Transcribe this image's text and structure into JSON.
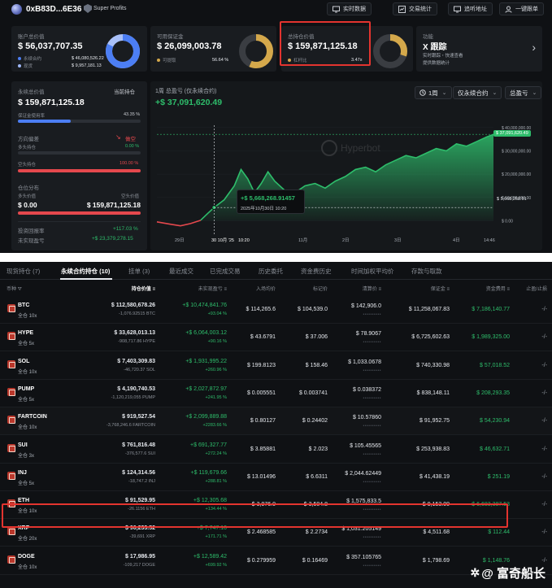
{
  "header": {
    "address": "0xB83D...6E36",
    "badge": "Super Profits",
    "buttons": [
      "实时数据",
      "交易统计",
      "追听地址",
      "一键跟单"
    ]
  },
  "cards": {
    "account": {
      "label": "账户总价值",
      "value": "$ 56,037,707.35",
      "rows": [
        {
          "label": "永续合约",
          "value": "$ 46,080,526.22"
        },
        {
          "label": "现货",
          "value": "$ 9,957,181.13"
        }
      ],
      "split": [
        0.82,
        0.18
      ]
    },
    "margin": {
      "label": "可用保证金",
      "value": "$ 26,099,003.78",
      "row_label": "可提取",
      "row_value": "56.64 %",
      "ratio": 0.5664
    },
    "position": {
      "label": "总持仓价值",
      "value": "$ 159,871,125.18",
      "row_label": "杠杆比",
      "row_value": "3.47x",
      "ratio": 0.3
    },
    "feature": {
      "label": "功能",
      "title": "X 跟踪",
      "line1": "实时跟踪・快速查看",
      "line2": "提供数据统计"
    }
  },
  "left": {
    "perp_label": "永续总价值",
    "current_label": "当前持仓",
    "perp_value": "$ 159,871,125.18",
    "margin_used_label": "保证金使用率",
    "margin_used_pct": "43.35 %",
    "margin_used_ratio": 0.4335,
    "direction_label": "方向偏差",
    "direction_value": "做空",
    "long_label": "多头持仓",
    "long_pct": "0.00 %",
    "short_label": "空头持仓",
    "short_pct": "100.00 %",
    "dist_label": "仓位分布",
    "long_value_label": "多头价值",
    "short_value_label": "空头价值",
    "long_value": "$ 0.00",
    "short_value": "$ 159,871,125.18",
    "roi_label": "投资回报率",
    "roi_value": "+117.03 %",
    "upnl_label": "未实现盈亏",
    "upnl_value": "+$ 23,379,278.15"
  },
  "chart": {
    "title": "1周 总盈亏 (仅永续合约)",
    "value": "+$ 37,091,620.49",
    "controls": {
      "range": "1周",
      "scope": "仅永续合约",
      "metric": "总盈亏"
    },
    "watermark": "Hyperbot",
    "tooltip": {
      "value": "+$ 5,668,268.91457",
      "date": "2025年10月30日 10:20"
    },
    "current_label": "$ 37,091,620.49",
    "marker_label": "$ 5,668,268.91"
  },
  "chart_data": {
    "type": "area",
    "title": "1周 总盈亏 (仅永续合约)",
    "x_ticks": [
      "29日",
      "30 10月 '25",
      "10:20",
      "11月",
      "2日",
      "3日",
      "4日",
      "14:46"
    ],
    "y_ticks": [
      "$ 40,000,000.00",
      "$ 30,000,000.00",
      "$ 20,000,000.00",
      "$ 10,000,000.00",
      "$ 0.00"
    ],
    "ylim": [
      -3000000,
      41000000
    ],
    "x": [
      0,
      0.04,
      0.07,
      0.1,
      0.13,
      0.15,
      0.17,
      0.2,
      0.23,
      0.25,
      0.27,
      0.29,
      0.31,
      0.33,
      0.35,
      0.38,
      0.41,
      0.44,
      0.47,
      0.5,
      0.53,
      0.56,
      0.59,
      0.62,
      0.65,
      0.68,
      0.71,
      0.74,
      0.77,
      0.8,
      0.83,
      0.86,
      0.89,
      0.92,
      0.95,
      0.98,
      1.0
    ],
    "values": [
      -500000,
      -1500000,
      -2200000,
      -1200000,
      200000,
      3000000,
      5668268,
      9000000,
      15000000,
      22000000,
      18000000,
      12000000,
      16000000,
      21000000,
      17000000,
      13000000,
      12000000,
      15000000,
      16000000,
      14000000,
      17000000,
      19000000,
      22000000,
      23000000,
      21000000,
      24000000,
      26000000,
      28000000,
      27000000,
      29000000,
      31000000,
      30000000,
      33000000,
      32000000,
      34000000,
      36000000,
      37091620
    ]
  },
  "tabs": [
    "现货持仓 (7)",
    "永续合约持仓 (10)",
    "挂单 (3)",
    "最近成交",
    "已完成交易",
    "历史委托",
    "资金费历史",
    "时间加权平均价",
    "存款与取款"
  ],
  "columns": [
    "币种",
    "持仓价值",
    "未实现盈亏",
    "入场均价",
    "标记价",
    "清算价",
    "保证金",
    "资金费用",
    "止盈/止损"
  ],
  "rows": [
    {
      "sym": "BTC",
      "lev": "全仓 10x",
      "value": "$ 112,580,678.26",
      "size": "-1,076.92515 BTC",
      "pnl": "+$ 10,474,841.76",
      "pnl_pct": "+93.04 %",
      "entry": "$ 114,265.6",
      "mark": "$ 104,539.0",
      "liq": "$ 142,906.0",
      "margin": "$ 11,258,067.83",
      "funding": "$ 7,186,140.77",
      "tpsl": "-/-"
    },
    {
      "sym": "HYPE",
      "lev": "全仓 5x",
      "value": "$ 33,628,013.13",
      "size": "-908,717.86 HYPE",
      "pnl": "+$ 6,064,003.12",
      "pnl_pct": "+90.16 %",
      "entry": "$ 43.6791",
      "mark": "$ 37.006",
      "liq": "$ 78.9067",
      "margin": "$ 6,725,602.63",
      "funding": "$ 1,989,325.00",
      "tpsl": "-/-"
    },
    {
      "sym": "SOL",
      "lev": "全仓 10x",
      "value": "$ 7,403,309.83",
      "size": "-46,720.37 SOL",
      "pnl": "+$ 1,931,995.22",
      "pnl_pct": "+260.96 %",
      "entry": "$ 199.8123",
      "mark": "$ 158.46",
      "liq": "$ 1,033.0678",
      "margin": "$ 740,330.98",
      "funding": "$ 57,018.52",
      "tpsl": "-/-"
    },
    {
      "sym": "PUMP",
      "lev": "全仓 5x",
      "value": "$ 4,190,740.53",
      "size": "-1,120,219,055 PUMP",
      "pnl": "+$ 2,027,872.97",
      "pnl_pct": "+241.95 %",
      "entry": "$ 0.005551",
      "mark": "$ 0.003741",
      "liq": "$ 0.038372",
      "margin": "$ 838,148.11",
      "funding": "$ 208,293.35",
      "tpsl": "-/-"
    },
    {
      "sym": "FARTCOIN",
      "lev": "全仓 10x",
      "value": "$ 919,527.54",
      "size": "-3,768,246.6 FARTCOIN",
      "pnl": "+$ 2,099,889.88",
      "pnl_pct": "+2283.66 %",
      "entry": "$ 0.80127",
      "mark": "$ 0.24402",
      "liq": "$ 10.57860",
      "margin": "$ 91,952.75",
      "funding": "$ 54,230.94",
      "tpsl": "-/-"
    },
    {
      "sym": "SUI",
      "lev": "全仓 3x",
      "value": "$ 761,816.48",
      "size": "-376,577.6 SUI",
      "pnl": "+$ 691,327.77",
      "pnl_pct": "+272.24 %",
      "entry": "$ 3.85881",
      "mark": "$ 2.023",
      "liq": "$ 105.45565",
      "margin": "$ 253,938.83",
      "funding": "$ 46,632.71",
      "tpsl": "-/-"
    },
    {
      "sym": "INJ",
      "lev": "全仓 5x",
      "value": "$ 124,314.56",
      "size": "-18,747.2 INJ",
      "pnl": "+$ 119,679.66",
      "pnl_pct": "+288.81 %",
      "entry": "$ 13.01496",
      "mark": "$ 6.6311",
      "liq": "$ 2,044.62449",
      "margin": "$ 41,438.19",
      "funding": "$ 251.19",
      "tpsl": "-/-"
    },
    {
      "sym": "ETH",
      "lev": "全仓 10x",
      "value": "$ 91,529.95",
      "size": "-26.1156 ETH",
      "pnl": "+$ 12,305.68",
      "pnl_pct": "+134.44 %",
      "entry": "$ 3,976.0",
      "mark": "$ 3,504.8",
      "liq": "$ 1,575,833.5",
      "margin": "$ 9,153.00",
      "funding": "$ 6,683,387.53",
      "tpsl": "-/-"
    },
    {
      "sym": "XRP",
      "lev": "全仓 20x",
      "value": "$ 90,233.52",
      "size": "-39,691 XRP",
      "pnl": "+$ 7,747.10",
      "pnl_pct": "+171.71 %",
      "entry": "$ 2.468585",
      "mark": "$ 2.2734",
      "liq": "$ 1,031.205149",
      "margin": "$ 4,511.68",
      "funding": "$ 112.44",
      "tpsl": "-/-"
    },
    {
      "sym": "DOGE",
      "lev": "全仓 10x",
      "value": "$ 17,986.95",
      "size": "-109,217 DOGE",
      "pnl": "+$ 12,589.42",
      "pnl_pct": "+699.92 %",
      "entry": "$ 0.279959",
      "mark": "$ 0.16469",
      "liq": "$ 357.105765",
      "margin": "$ 1,798.69",
      "funding": "$ 1,148.76",
      "tpsl": "-/-"
    }
  ],
  "watermark": "@ 富奇船长",
  "colors": {
    "green": "#2ebd6b",
    "red": "#e5484d",
    "blue": "#4c7ef3",
    "gold": "#d4a84b",
    "highlight": "#e3342f"
  }
}
